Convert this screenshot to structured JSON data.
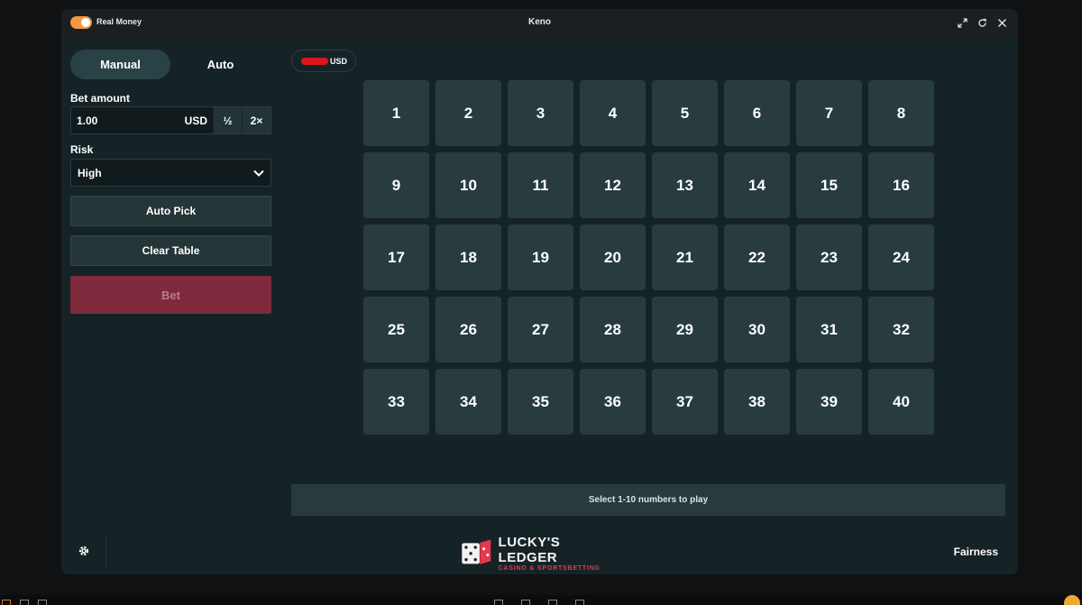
{
  "titlebar": {
    "mode_label": "Real Money",
    "game_title": "Keno",
    "icons": [
      "expand-icon",
      "refresh-icon",
      "close-icon"
    ],
    "toggle_color": "#f39a3e"
  },
  "tabs": [
    {
      "label": "Manual",
      "active": true
    },
    {
      "label": "Auto",
      "active": false
    }
  ],
  "bet": {
    "label": "Bet amount",
    "value": "1.00",
    "currency": "USD",
    "half_label": "½",
    "double_label": "2×"
  },
  "risk": {
    "label": "Risk",
    "selected": "High"
  },
  "buttons": {
    "auto_pick": "Auto Pick",
    "clear_table": "Clear Table",
    "bet": "Bet"
  },
  "balance": {
    "currency": "USD"
  },
  "numbers": [
    "1",
    "2",
    "3",
    "4",
    "5",
    "6",
    "7",
    "8",
    "9",
    "10",
    "11",
    "12",
    "13",
    "14",
    "15",
    "16",
    "17",
    "18",
    "19",
    "20",
    "21",
    "22",
    "23",
    "24",
    "25",
    "26",
    "27",
    "28",
    "29",
    "30",
    "31",
    "32",
    "33",
    "34",
    "35",
    "36",
    "37",
    "38",
    "39",
    "40"
  ],
  "status": {
    "message": "Select 1-10 numbers to play"
  },
  "footer": {
    "logo_name": "LUCKY'S LEDGER",
    "logo_sub": "CASINO & SPORTSBETTING",
    "fairness_label": "Fairness"
  },
  "colors": {
    "accent": "#f39a3e",
    "bet_button": "#7e2a3c",
    "tile": "#283c40",
    "panel": "#162326",
    "logo_red": "#e8384f"
  }
}
